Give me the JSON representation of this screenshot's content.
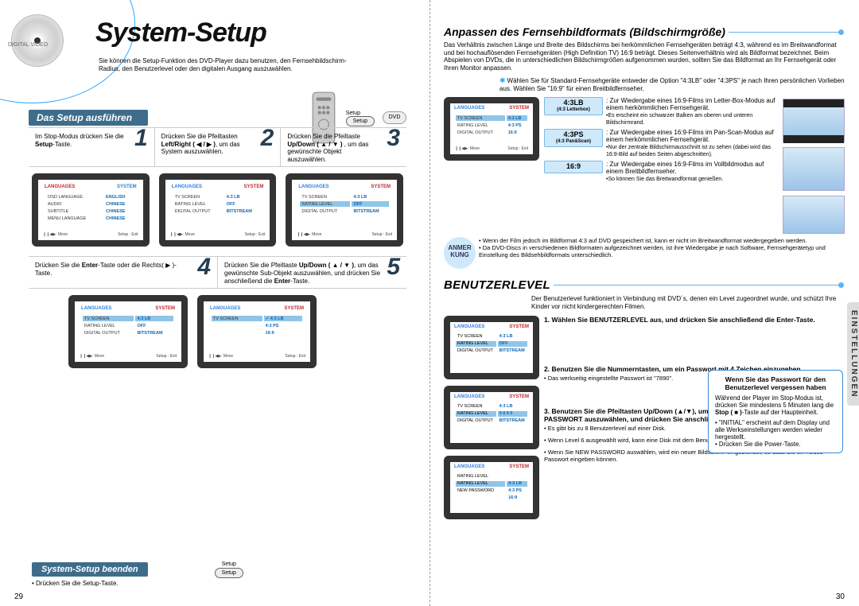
{
  "left": {
    "disc_label": "DIGITAL VIDEO",
    "title": "System-Setup",
    "intro": "Sie können die Setup-Funktion des DVD-Player dazu benutzen, den Fernsehbildschirm-Radius, den Benutzerlevel oder den digitalen Ausgang auszuwählen.",
    "setup_label": "Setup",
    "das_setup": "Das Setup ausführen",
    "dvd_badge": "DVD",
    "step1": {
      "num": "1",
      "text": "Im Stop-Modus drücken Sie die ",
      "strong": "Setup",
      "text2": "-Taste."
    },
    "step2": {
      "num": "2",
      "text": "Drücken Sie die Pfeiltasten ",
      "strong": "Left/Right ( ◀ / ▶ )",
      "text2": ", um das System auszuwählen."
    },
    "step3": {
      "num": "3",
      "text": "Drücken Sie die Pfeiltaste ",
      "strong": "Up/Down ( ▲ / ▼ )",
      "text2": " , um das gewünschte Objekt auszuwählen."
    },
    "step4": {
      "num": "4",
      "text": "Drücken Sie die ",
      "strong": "Enter",
      "text2": "-Taste oder die Rechts( ▶ )-Taste."
    },
    "step5": {
      "num": "5",
      "text": "Drücken Sie die Pfeiltaste ",
      "strong": "Up/Down ( ▲ / ▼ )",
      "text2": ", um das gewünschte Sub-Objekt auszuwählen, und drücken Sie anschließend die ",
      "strong2": "Enter",
      "text3": "-Taste."
    },
    "tv_common": {
      "languages": "LANGUAGES",
      "system": "SYSTEM",
      "footer_l": "❙❙◀▶: Move",
      "footer_r": "Setup : Exit"
    },
    "tv1": {
      "rows": [
        [
          "OSD LANGUAGE",
          "ENGLISH"
        ],
        [
          "AUDIO",
          "CHINESE"
        ],
        [
          "SUBTITLE",
          "CHINESE"
        ],
        [
          "MENU LANGUAGE",
          "CHINESE"
        ]
      ]
    },
    "tv2": {
      "rows": [
        [
          "TV SCREEN",
          "4:3 LB"
        ],
        [
          "RATING LEVEL",
          "OFF"
        ],
        [
          "DIGITAL OUTPUT",
          "BITSTREAM"
        ]
      ]
    },
    "tv3": {
      "rows": [
        [
          "TV SCREEN",
          "4:3 LB"
        ],
        [
          "RATING LEVEL",
          "OFF"
        ],
        [
          "DIGITAL OUTPUT",
          "BITSTREAM"
        ]
      ],
      "hl_row": 1
    },
    "tv4": {
      "rows": [
        [
          "TV SCREEN",
          "4:3 LB"
        ],
        [
          "RATING LEVEL",
          "OFF"
        ],
        [
          "DIGITAL OUTPUT",
          "BITSTREAM"
        ]
      ],
      "hl_row": 0
    },
    "tv5": {
      "rows": [
        [
          "TV SCREEN",
          "✓ 4:3 LB"
        ],
        [
          "",
          "4:3 PS"
        ],
        [
          "",
          "16:9"
        ]
      ],
      "hl_row": 0
    },
    "finish_title": "System-Setup beenden",
    "finish_text": "• Drücken Sie die Setup-Taste.",
    "pagenum": "29"
  },
  "right": {
    "title": "Anpassen des Fernsehbildformats (Bildschirmgröße)",
    "para1": "Das Verhältnis zwischen Länge und Breite des Bildschirms bei herkömmlichen Fernsehgeräten beträgt 4:3, während es im Breitwandformat und bei hochauflösenden Fernsehgeräten (High Definition TV) 16:9 beträgt. Dieses Seitenverhältnis wird als Bildformat bezeichnet. Beim Abspielen von DVDs, die in unterschiedlichen Bildschirmgrößen aufgenommen wurden, sollten Sie das Bildformat an Ihr Fernsehgerät oder Ihren Monitor anpassen.",
    "note1": "Wählen Sie für Standard-Fernsehgeräte entweder die Option \"4:3LB\" oder \"4:3PS\" je nach Ihren persönlichen Vorlieben aus. Wählen Sie \"16:9\" für einen Breitbildfernseher.",
    "aspect_tv": {
      "rows": [
        [
          "TV SCREEN",
          "4:3 LB"
        ],
        [
          "RATING LEVEL",
          "4:3 PS"
        ],
        [
          "DIGITAL OUTPUT",
          "16:9"
        ]
      ]
    },
    "opt43lb": {
      "label": "4:3LB",
      "sub": "(4:3 Letterbox)",
      "desc": ": Zur Wiedergabe eines 16:9-Films im Letter-Box-Modus auf einem herkömmlichen Fernsehgerät.",
      "note": "•Es erscheint ein schwarzer Balken am oberen und unteren Bildschirmrand."
    },
    "opt43ps": {
      "label": "4:3PS",
      "sub": "(4:3 Pan&Scan)",
      "desc": ": Zur Wiedergabe eines 16:9-Films im Pan-Scan-Modus auf einem herkömmlichen Fernsehgerät.",
      "note": "•Nur der zentrale Bildschirmausschnitt ist zu sehen (dabei wird das 16:9-Bild auf beiden Seiten abgeschnitten)."
    },
    "opt169": {
      "label": "16:9",
      "sub": "",
      "desc": ": Zur Wiedergabe eines 16:9-Films im Vollbildmodus auf einem Breitbildfernseher.",
      "note": "•So können Sie das Breitwandformat genießen."
    },
    "anmer_label": "ANMER\nKUNG",
    "anmer_list": [
      "• Wenn der Film jedoch im Bildformat 4:3 auf DVD gespeichert ist, kann er nicht im Breitwandformat wiedergegeben werden.",
      "• Da DVD-Discs in verschiedenen Bildformaten aufgezeichnet werden, ist ihre Wiedergabe je nach Software, Fernsehgerätetyp und Einstellung des Bildsehbildformats unterschiedlich."
    ],
    "benutz_title": "BENUTZERLEVEL",
    "benutz_intro": "Der Benutzerlevel funktioniert in Verbindung mit DVD´s, denen ein Level zugeordnet wurde, und schützt Ihre Kinder vor nicht kindergerechten Filmen.",
    "b_tv1": {
      "rows": [
        [
          "TV SCREEN",
          "4:3 LB"
        ],
        [
          "RATING LEVEL",
          "OFF"
        ],
        [
          "DIGITAL OUTPUT",
          "BITSTREAM"
        ]
      ],
      "hl": 1
    },
    "b_tv2": {
      "rows": [
        [
          "TV SCREEN",
          "4:3 LB"
        ],
        [
          "RATING LEVEL",
          "0 0 0 0"
        ],
        [
          "DIGITAL OUTPUT",
          "BITSTREAM"
        ]
      ],
      "hl": 1
    },
    "b_tv3": {
      "rows": [
        [
          "RATING LEVEL",
          ""
        ],
        [
          "RATING LEVEL",
          "4:3 LB"
        ],
        [
          "NEW PASSWORD",
          "4:3 PS"
        ],
        [
          "",
          "16:9"
        ]
      ]
    },
    "bstep1": "1. Wählen Sie BENUTZERLEVEL aus, und drücken Sie anschließend die Enter-Taste.",
    "bstep2": "2. Benutzen Sie die Nummerntasten, um ein Passwort mit 4 Zeichen einzugeben.",
    "bstep2_note": "• Das werkseitig eingestellte Passwort ist \"7890\".",
    "bstep3": "3. Benutzen Sie die Pfeiltasten Up/Down (▲/▼), um entweder BENUTZERLEVEL oder NEUES PASSWORT auszuwählen, und drücken Sie anschließend die Enter-Taste.",
    "bstep3_notes": [
      "• Es gibt bis zu 8 Benutzerlevel auf einer Disk.",
      "• Wenn Level 6 ausgewählt wird, kann eine Disk mit dem Benutzerlevel 7 oder höher nicht abgespielt werden.",
      "• Wenn Sie NEW PASSWORD auswählen, wird ein neuer Bildschirm eingeblendet, so dass Sie ein neues Passwort eingeben können."
    ],
    "pass_title": "Wenn Sie das Passwort für den Benutzerlevel vergessen haben",
    "pass_body1": "Während der Player im Stop-Modus ist, drücken Sie mindestens 5 Minuten lang die ",
    "pass_body1_b": "Stop ( ■ )",
    "pass_body1_c": "-Taste auf der Haupteinheit.",
    "pass_li1": "• \"INITIAL\" erscheint auf dem Display und alle Werkseinstellungen werden wieder hergestellt.",
    "pass_li2": "• Drücken Sie die Power-Taste.",
    "sidetab": "EINSTELLUNGEN",
    "pagenum": "30"
  }
}
